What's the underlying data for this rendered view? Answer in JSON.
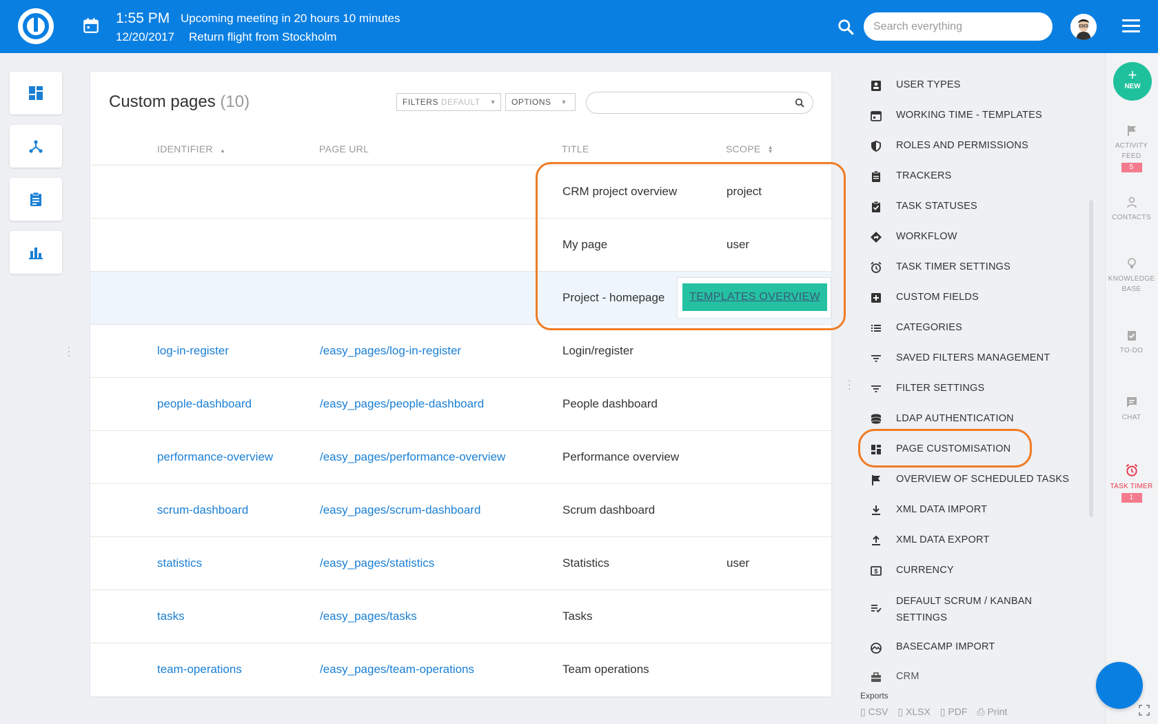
{
  "topbar": {
    "time": "1:55 PM",
    "date": "12/20/2017",
    "meeting": "Upcoming meeting in 20 hours 10 minutes",
    "flight": "Return flight from Stockholm",
    "search_placeholder": "Search everything"
  },
  "main": {
    "title": "Custom pages",
    "count": "(10)",
    "filters_label": "FILTERS",
    "filters_value": "DEFAULT",
    "options_label": "OPTIONS",
    "columns": {
      "identifier": "IDENTIFIER",
      "page_url": "PAGE URL",
      "title": "TITLE",
      "scope": "SCOPE"
    },
    "rows": [
      {
        "identifier": "",
        "url": "",
        "title": "CRM project overview",
        "scope": "project"
      },
      {
        "identifier": "",
        "url": "",
        "title": "My page",
        "scope": "user"
      },
      {
        "identifier": "",
        "url": "",
        "title": "Project - homepage",
        "scope": ""
      },
      {
        "identifier": "log-in-register",
        "url": "/easy_pages/log-in-register",
        "title": "Login/register",
        "scope": ""
      },
      {
        "identifier": "people-dashboard",
        "url": "/easy_pages/people-dashboard",
        "title": "People dashboard",
        "scope": ""
      },
      {
        "identifier": "performance-overview",
        "url": "/easy_pages/performance-overview",
        "title": "Performance overview",
        "scope": ""
      },
      {
        "identifier": "scrum-dashboard",
        "url": "/easy_pages/scrum-dashboard",
        "title": "Scrum dashboard",
        "scope": ""
      },
      {
        "identifier": "statistics",
        "url": "/easy_pages/statistics",
        "title": "Statistics",
        "scope": "user"
      },
      {
        "identifier": "tasks",
        "url": "/easy_pages/tasks",
        "title": "Tasks",
        "scope": ""
      },
      {
        "identifier": "team-operations",
        "url": "/easy_pages/team-operations",
        "title": "Team operations",
        "scope": ""
      }
    ],
    "templates_button": "TEMPLATES OVERVIEW"
  },
  "admin_menu": {
    "items": [
      "USER TYPES",
      "WORKING TIME - TEMPLATES",
      "ROLES AND PERMISSIONS",
      "TRACKERS",
      "TASK STATUSES",
      "WORKFLOW",
      "TASK TIMER SETTINGS",
      "CUSTOM FIELDS",
      "CATEGORIES",
      "SAVED FILTERS MANAGEMENT",
      "FILTER SETTINGS",
      "LDAP AUTHENTICATION",
      "PAGE CUSTOMISATION",
      "OVERVIEW OF SCHEDULED TASKS",
      "XML DATA IMPORT",
      "XML DATA EXPORT",
      "CURRENCY",
      "DEFAULT SCRUM / KANBAN",
      "BASECAMP IMPORT",
      "CRM"
    ],
    "item_16_line2": "SETTINGS"
  },
  "exports": {
    "label": "Exports",
    "csv": "CSV",
    "xlsx": "XLSX",
    "pdf": "PDF",
    "print": "Print"
  },
  "rail": {
    "new_label": "NEW",
    "activity_line1": "ACTIVITY",
    "activity_line2": "FEED",
    "activity_badge": "5",
    "contacts": "CONTACTS",
    "kb_line1": "KNOWLEDGE",
    "kb_line2": "BASE",
    "todo": "TO-DO",
    "chat": "CHAT",
    "timer": "TASK TIMER",
    "timer_badge": "1"
  },
  "colors": {
    "brand_blue": "#0a7fe2",
    "accent_green": "#1fc19c",
    "highlight_orange": "#f07c24",
    "link_blue": "#1a7fd4"
  }
}
